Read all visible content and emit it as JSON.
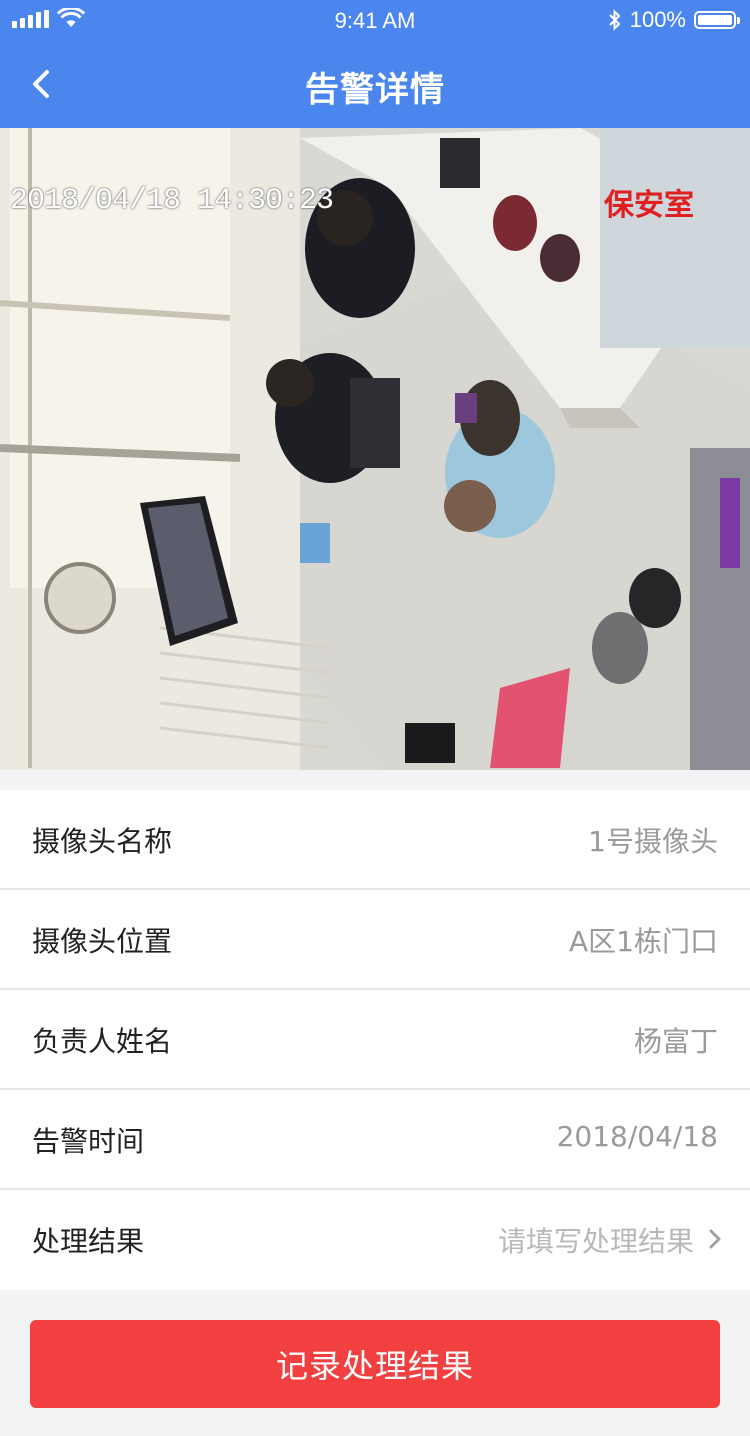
{
  "status_bar": {
    "time": "9:41 AM",
    "battery": "100%"
  },
  "nav": {
    "title": "告警详情",
    "back_icon": "chevron-left-icon"
  },
  "camera": {
    "timestamp": "2018/04/18 14:30:23",
    "location_label": "保安室"
  },
  "details": [
    {
      "label": "摄像头名称",
      "value": "1号摄像头"
    },
    {
      "label": "摄像头位置",
      "value": "A区1栋门口"
    },
    {
      "label": "负责人姓名",
      "value": "杨富丁"
    },
    {
      "label": "告警时间",
      "value": "2018/04/18"
    }
  ],
  "result": {
    "label": "处理结果",
    "placeholder": "请填写处理结果"
  },
  "submit_label": "记录处理结果",
  "colors": {
    "header": "#4a86ee",
    "button": "#f23f3f"
  }
}
